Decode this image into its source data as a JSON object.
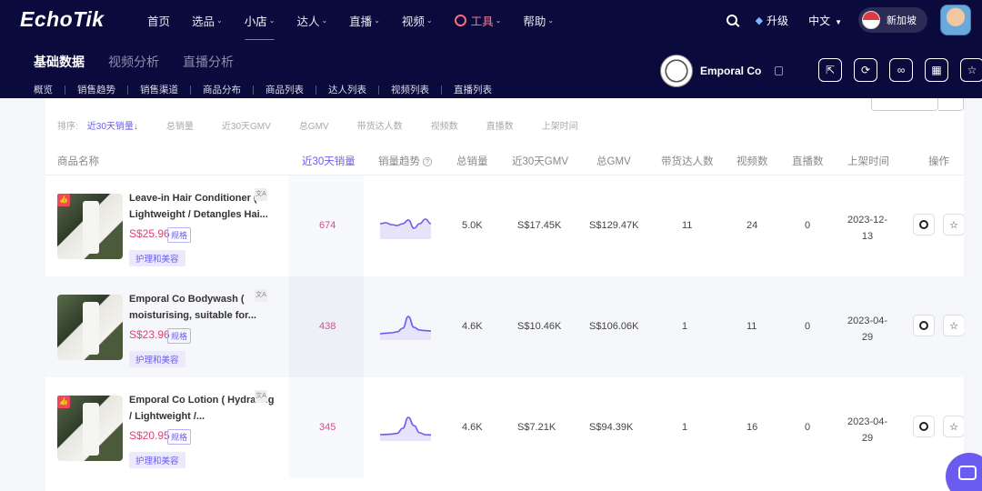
{
  "app": {
    "logo": "EchoTik",
    "nav": [
      {
        "label": "首页",
        "chevron": false
      },
      {
        "label": "选品",
        "chevron": true
      },
      {
        "label": "小店",
        "chevron": true,
        "active": true
      },
      {
        "label": "达人",
        "chevron": true
      },
      {
        "label": "直播",
        "chevron": true
      },
      {
        "label": "视频",
        "chevron": true
      },
      {
        "label": "工具",
        "chevron": true
      },
      {
        "label": "帮助",
        "chevron": true
      }
    ],
    "upgrade": "升级",
    "language": "中文",
    "region": "新加坡",
    "accent": "#6a5cf0"
  },
  "subtabs": [
    "基础数据",
    "视频分析",
    "直播分析"
  ],
  "subnav": [
    "概览",
    "销售趋势",
    "销售渠道",
    "商品分布",
    "商品列表",
    "达人列表",
    "视频列表",
    "直播列表"
  ],
  "shop": {
    "name": "Emporal Co"
  },
  "sortbar": {
    "label": "排序:",
    "options": [
      "近30天销量",
      "总销量",
      "近30天GMV",
      "总GMV",
      "带货达人数",
      "视频数",
      "直播数",
      "上架时间"
    ],
    "active_arrow": "↓"
  },
  "table": {
    "headers": [
      "商品名称",
      "近30天销量",
      "销量趋势",
      "总销量",
      "近30天GMV",
      "总GMV",
      "带货达人数",
      "视频数",
      "直播数",
      "上架时间",
      "操作"
    ],
    "rows": [
      {
        "name": "Leave-in Hair Conditioner ( Lightweight / Detangles Hai...",
        "price": "S$25.96",
        "spec": "规格",
        "category": "护理和美容",
        "sales30": "674",
        "total_sales": "5.0K",
        "gmv30": "S$17.45K",
        "total_gmv": "S$129.47K",
        "creators": "11",
        "videos": "24",
        "lives": "0",
        "date_line1": "2023-12-",
        "date_line2": "13",
        "hot": true,
        "trend": [
          0.55,
          0.6,
          0.5,
          0.45,
          0.55,
          0.75,
          0.3,
          0.55,
          0.8,
          0.55
        ]
      },
      {
        "name": "Emporal Co Bodywash ( moisturising, suitable for...",
        "price": "S$23.96",
        "spec": "规格",
        "category": "护理和美容",
        "sales30": "438",
        "total_sales": "4.6K",
        "gmv30": "S$10.46K",
        "total_gmv": "S$106.06K",
        "creators": "1",
        "videos": "11",
        "lives": "0",
        "date_line1": "2023-04-",
        "date_line2": "29",
        "hot": false,
        "trend": [
          0.05,
          0.08,
          0.1,
          0.15,
          0.35,
          1.0,
          0.4,
          0.25,
          0.22,
          0.2
        ]
      },
      {
        "name": "Emporal Co Lotion ( Hydrating / Lightweight /...",
        "price": "S$20.95",
        "spec": "规格",
        "category": "护理和美容",
        "sales30": "345",
        "total_sales": "4.6K",
        "gmv30": "S$7.21K",
        "total_gmv": "S$94.39K",
        "creators": "1",
        "videos": "16",
        "lives": "0",
        "date_line1": "2023-04-",
        "date_line2": "29",
        "hot": true,
        "trend": [
          0.05,
          0.06,
          0.08,
          0.12,
          0.4,
          1.0,
          0.55,
          0.15,
          0.05,
          0.03
        ]
      }
    ]
  }
}
